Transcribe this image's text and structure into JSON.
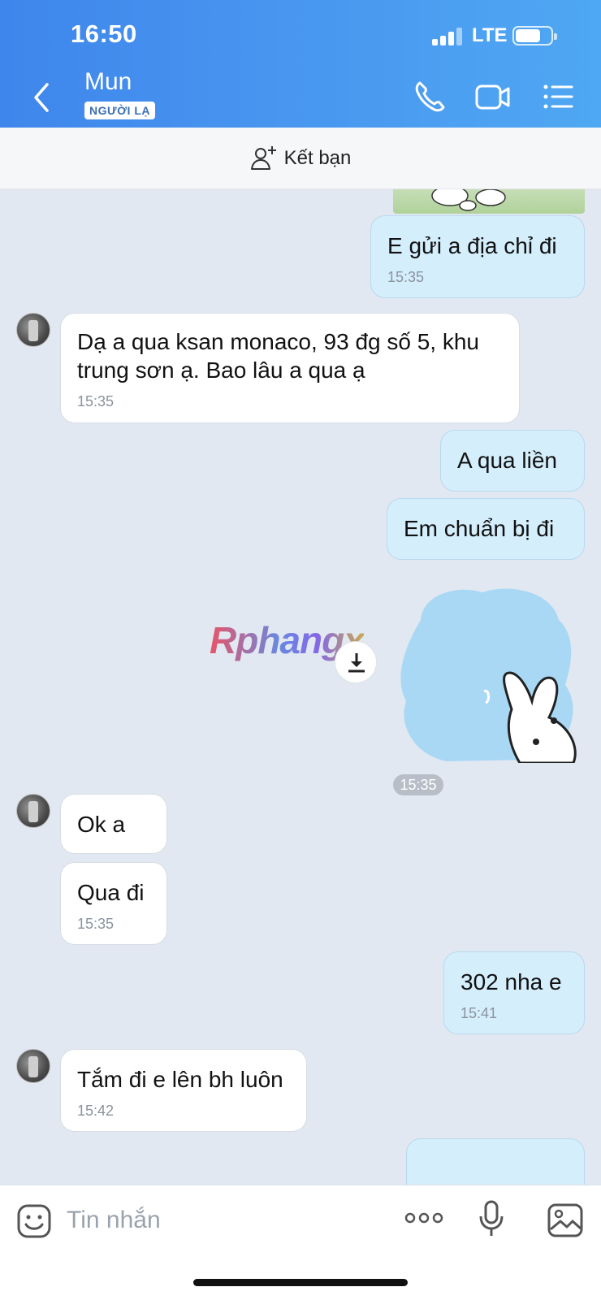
{
  "status_bar": {
    "time": "16:50",
    "network": "LTE"
  },
  "header": {
    "contact_name": "Mun",
    "badge": "NGƯỜI LẠ"
  },
  "friend_bar": {
    "label": "Kết bạn"
  },
  "messages": [
    {
      "dir": "out",
      "text": "E gửi a địa chỉ đi",
      "time": "15:35"
    },
    {
      "dir": "in",
      "text": "Dạ a qua ksan monaco, 93 đg số 5, khu trung sơn ạ. Bao lâu a qua ạ",
      "time": "15:35"
    },
    {
      "dir": "out",
      "text": "A qua liền"
    },
    {
      "dir": "out",
      "text": "Em chuẩn bị đi"
    },
    {
      "dir": "in",
      "text": "Ok a"
    },
    {
      "dir": "in",
      "text": "Qua đi",
      "time": "15:35"
    },
    {
      "dir": "out",
      "text": "302 nha e",
      "time": "15:41"
    },
    {
      "dir": "in",
      "text": "Tắm đi e lên bh luôn",
      "time": "15:42"
    }
  ],
  "sticker_time": "15:35",
  "watermark": "Rphangx",
  "composer": {
    "placeholder": "Tin nhắn"
  },
  "colors": {
    "header": "#4a9af0",
    "out_bubble": "#d5eefc",
    "in_bubble": "#ffffff",
    "chat_bg": "#e2e8f1"
  },
  "icons": [
    "back-icon",
    "phone-icon",
    "video-icon",
    "menu-icon",
    "add-friend-icon",
    "download-icon",
    "emoji-icon",
    "more-icon",
    "mic-icon",
    "image-icon"
  ]
}
